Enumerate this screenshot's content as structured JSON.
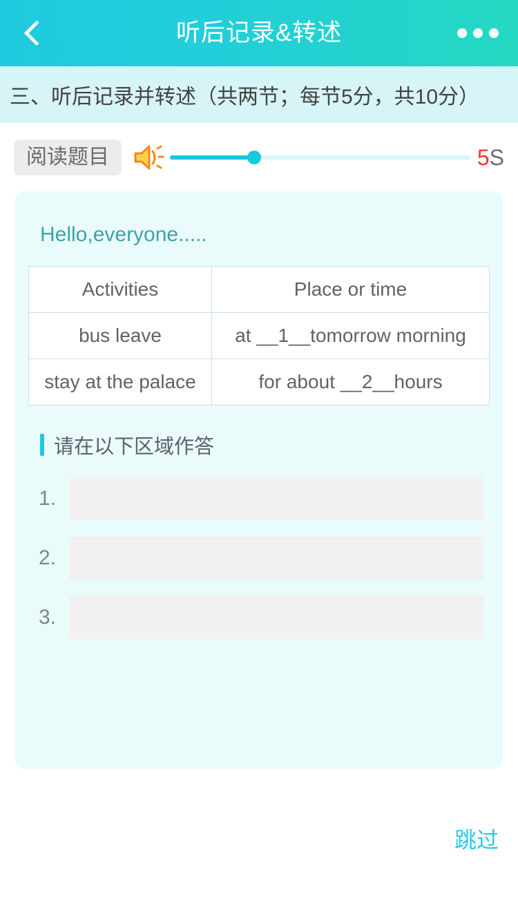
{
  "header": {
    "title": "听后记录&转述",
    "back_icon": "chevron-left-icon",
    "more_icon": "ellipsis-icon",
    "gradient_start": "#1fc9e0",
    "gradient_end": "#24d8c2"
  },
  "section": {
    "title": "三、听后记录并转述（共两节；每节5分，共10分）",
    "background": "#d7f4f7"
  },
  "audio": {
    "read_button_label": "阅读题目",
    "speaker_icon": "speaker-icon",
    "progress_percent": 28,
    "timer_value": "5",
    "timer_unit": "S",
    "timer_color": "#f33535",
    "track_color": "#d9f6f9",
    "fill_color": "#16c6dd"
  },
  "card": {
    "greeting": "Hello,everyone.....",
    "background": "#eafbfc",
    "table": {
      "headers": [
        "Activities",
        "Place or time"
      ],
      "rows": [
        [
          "bus leave",
          "at __1__tomorrow morning"
        ],
        [
          "stay at the palace",
          "for about __2__hours"
        ]
      ]
    },
    "answer_heading": "请在以下区域作答",
    "answers": [
      {
        "number": "1.",
        "value": "",
        "placeholder": ""
      },
      {
        "number": "2.",
        "value": "",
        "placeholder": ""
      },
      {
        "number": "3.",
        "value": "",
        "placeholder": ""
      }
    ]
  },
  "footer": {
    "skip_label": "跳过",
    "skip_color": "#2ac8e2"
  }
}
